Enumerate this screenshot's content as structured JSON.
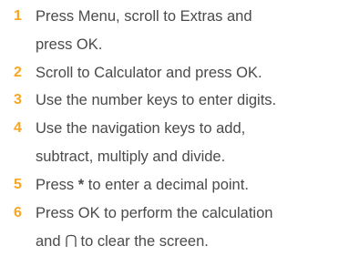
{
  "steps": [
    {
      "number": "1",
      "line1": "Press Menu, scroll to Extras and",
      "line2": "press OK."
    },
    {
      "number": "2",
      "line1": "Scroll to Calculator and press OK."
    },
    {
      "number": "3",
      "line1": "Use the number keys to enter digits."
    },
    {
      "number": "4",
      "line1": "Use the navigation keys to add,",
      "line2": "subtract, multiply and divide."
    },
    {
      "number": "5",
      "line1_pre": "Press",
      "line1_symbol": "*",
      "line1_post": "to enter a decimal point."
    },
    {
      "number": "6",
      "line1": "Press OK to perform the calculation",
      "line2_pre": "and",
      "line2_icon": "clear-key-icon",
      "line2_post": "to clear the screen."
    }
  ],
  "colors": {
    "accent": "#f6a623",
    "text": "#4a4a4a"
  }
}
